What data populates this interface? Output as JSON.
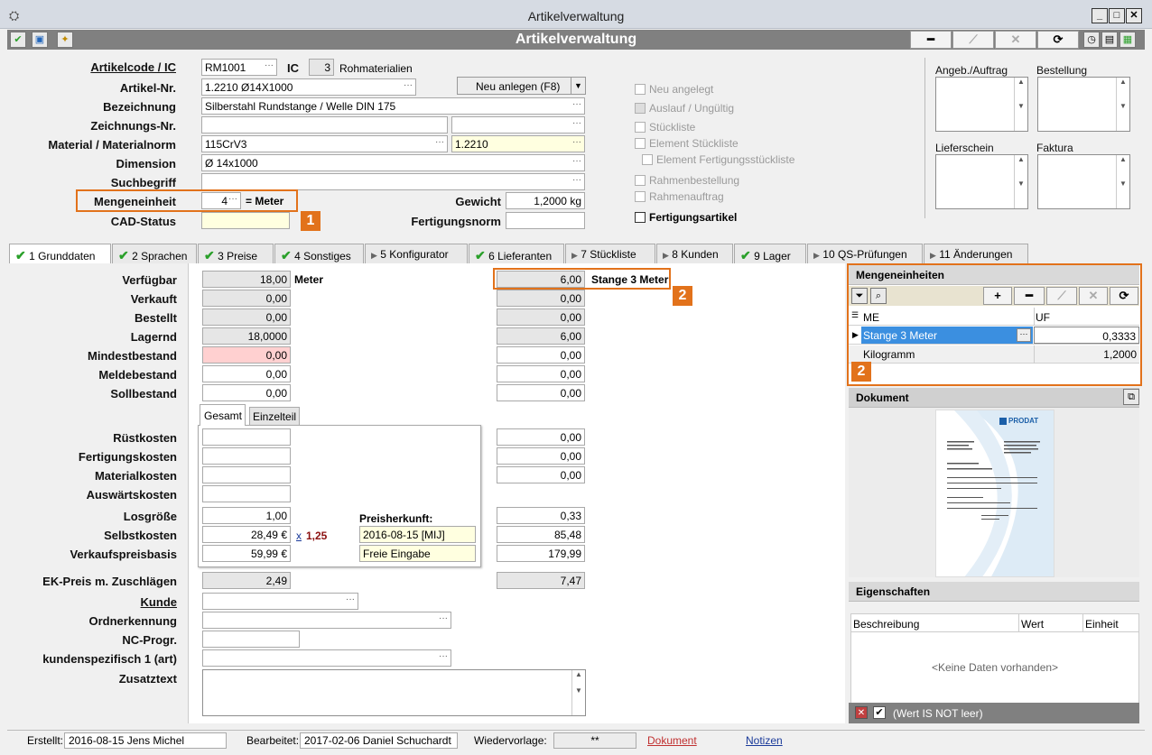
{
  "window": {
    "title": "Artikelverwaltung",
    "app_title": "Artikelverwaltung"
  },
  "header": {
    "artikelcode_label": "Artikelcode / IC",
    "artikelcode": "RM1001",
    "ic_label": "IC",
    "ic_value": "3",
    "ic_text": "Rohmaterialien",
    "artikelnr_label": "Artikel-Nr.",
    "artikelnr": "1.2210 Ø14X1000",
    "neu_anlegen": "Neu anlegen (F8)",
    "bezeichnung_label": "Bezeichnung",
    "bezeichnung": "Silberstahl Rundstange / Welle DIN 175",
    "zeichnung_label": "Zeichnungs-Nr.",
    "material_label": "Material / Materialnorm",
    "material": "115CrV3",
    "materialnorm": "1.2210",
    "dimension_label": "Dimension",
    "dimension": "Ø 14x1000",
    "suchbegriff_label": "Suchbegriff",
    "mengeneinheit_label": "Mengeneinheit",
    "mengeneinheit_value": "4",
    "mengeneinheit_text": "= Meter",
    "gewicht_label": "Gewicht",
    "gewicht": "1,2000 kg",
    "cad_label": "CAD-Status",
    "fertigungsnorm_label": "Fertigungsnorm"
  },
  "checks": [
    {
      "label": "Neu angelegt",
      "on": false
    },
    {
      "label": "Auslauf / Ungültig",
      "on": false
    },
    {
      "label": "Stückliste",
      "on": false
    },
    {
      "label": "Element Stückliste",
      "on": false
    },
    {
      "label": "Element Fertigungsstückliste",
      "on": false
    },
    {
      "label": "Rahmenbestellung",
      "on": false
    },
    {
      "label": "Rahmenauftrag",
      "on": false
    },
    {
      "label": "Fertigungsartikel",
      "on": true
    }
  ],
  "notes": {
    "angeb": "Angeb./Auftrag",
    "bestellung": "Bestellung",
    "lieferschein": "Lieferschein",
    "faktura": "Faktura"
  },
  "tabs": [
    "1 Grunddaten",
    "2 Sprachen",
    "3 Preise",
    "4 Sonstiges",
    "5 Konfigurator",
    "6 Lieferanten",
    "7 Stückliste",
    "8 Kunden",
    "9 Lager",
    "10 QS-Prüfungen",
    "11 Änderungen"
  ],
  "grund": {
    "rows": [
      {
        "label": "Verfügbar",
        "v1": "18,00",
        "v2": "6,00"
      },
      {
        "label": "Verkauft",
        "v1": "0,00",
        "v2": "0,00"
      },
      {
        "label": "Bestellt",
        "v1": "0,00",
        "v2": "0,00"
      },
      {
        "label": "Lagernd",
        "v1": "18,0000",
        "v2": "6,00"
      },
      {
        "label": "Mindestbestand",
        "v1": "0,00",
        "v2": "0,00"
      },
      {
        "label": "Meldebestand",
        "v1": "0,00",
        "v2": "0,00"
      },
      {
        "label": "Sollbestand",
        "v1": "0,00",
        "v2": "0,00"
      }
    ],
    "unit1": "Meter",
    "unit2": "Stange 3 Meter",
    "subtab1": "Gesamt",
    "subtab2": "Einzelteil",
    "cost_rows": [
      {
        "label": "Rüstkosten",
        "v1": "",
        "v2": "0,00"
      },
      {
        "label": "Fertigungskosten",
        "v1": "",
        "v2": "0,00"
      },
      {
        "label": "Materialkosten",
        "v1": "",
        "v2": "0,00"
      },
      {
        "label": "Auswärtskosten",
        "v1": "",
        "v2": ""
      },
      {
        "label": "Losgröße",
        "v1": "1,00",
        "v2": "0,33"
      },
      {
        "label": "Selbstkosten",
        "v1": "28,49 €",
        "v2": "85,48"
      },
      {
        "label": "Verkaufspreisbasis",
        "v1": "59,99 €",
        "v2": "179,99"
      }
    ],
    "factor_x": "x",
    "factor": "1,25",
    "preisherkunft_label": "Preisherkunft:",
    "preisherkunft_date": "2016-08-15 [MIJ]",
    "preisherkunft_src": "Freie Eingabe",
    "ek_label": "EK-Preis m. Zuschlägen",
    "ek1": "2,49",
    "ek2": "7,47",
    "kunde_label": "Kunde",
    "ordner_label": "Ordnerkennung",
    "nc_label": "NC-Progr.",
    "kunden1_label": "kundenspezifisch 1 (art)",
    "zusatz_label": "Zusatztext"
  },
  "me_panel": {
    "title": "Mengeneinheiten",
    "col_me": "ME",
    "col_uf": "UF",
    "rows": [
      {
        "me": "Stange 3 Meter",
        "uf": "0,3333"
      },
      {
        "me": "Kilogramm",
        "uf": "1,2000"
      }
    ]
  },
  "doc_panel": {
    "title": "Dokument",
    "logo": "PRODAT"
  },
  "props_panel": {
    "title": "Eigenschaften",
    "col1": "Beschreibung",
    "col2": "Wert",
    "col3": "Einheit",
    "empty": "<Keine Daten vorhanden>",
    "filter": "(Wert IS NOT leer)"
  },
  "status": {
    "erstellt_label": "Erstellt:",
    "erstellt": "2016-08-15  Jens Michel",
    "bearbeitet_label": "Bearbeitet:",
    "bearbeitet": "2017-02-06  Daniel Schuchardt",
    "wv_label": "Wiedervorlage:",
    "wv": "**",
    "dokument": "Dokument",
    "notizen": "Notizen"
  },
  "markers": {
    "m1": "1",
    "m2": "2",
    "m3": "2"
  },
  "colors": {
    "accent": "#e2721b",
    "ok": "#2aa02a",
    "selected": "#3b8fe0"
  }
}
